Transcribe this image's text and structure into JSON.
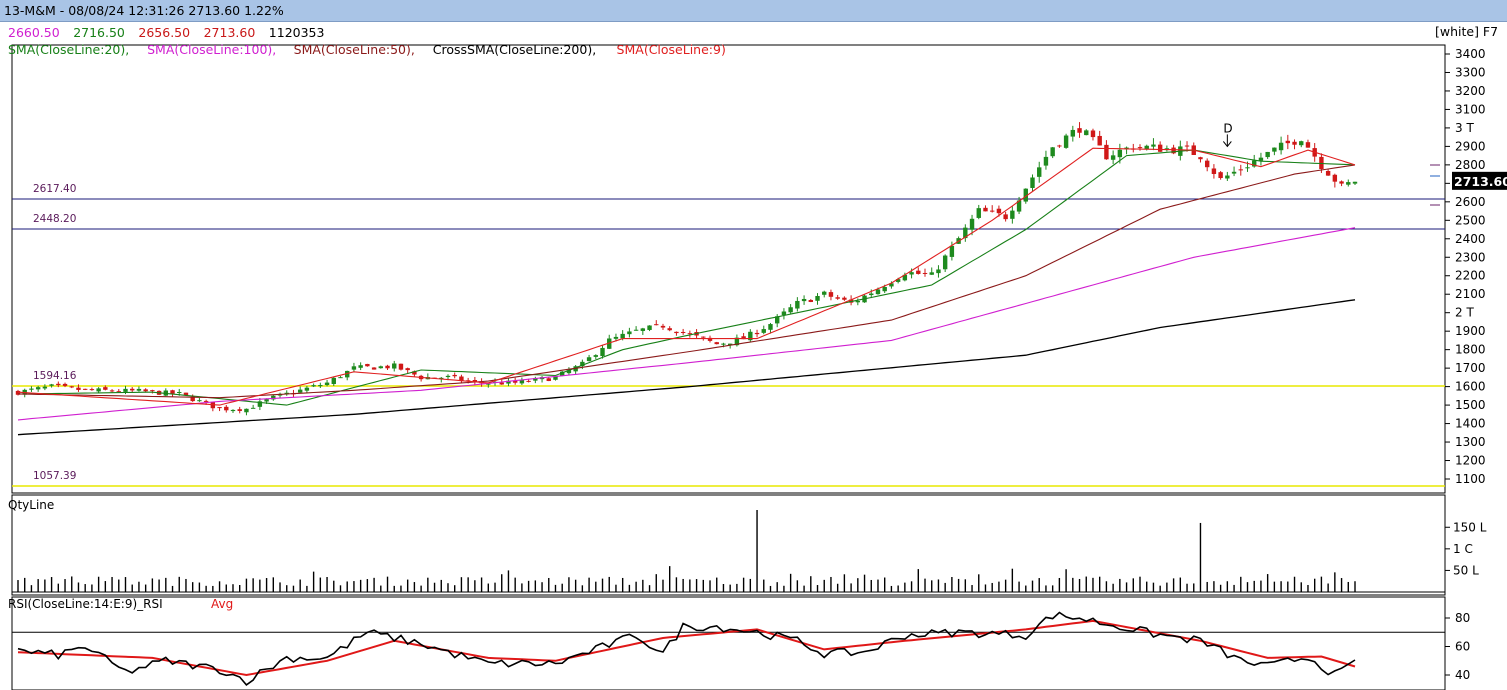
{
  "header": {
    "title": "13-M&M - 08/08/24 12:31:26 2713.60 1.22%",
    "ohlc": [
      {
        "text": "2660.50",
        "color": "#d020d0"
      },
      {
        "text": "2716.50",
        "color": "#188018"
      },
      {
        "text": "2656.50",
        "color": "#c81818"
      },
      {
        "text": "2713.60",
        "color": "#c81818"
      },
      {
        "text": "1120353",
        "color": "#000000"
      }
    ],
    "indicators": [
      {
        "text": "SMA(CloseLine:20),",
        "color": "#188018"
      },
      {
        "text": "SMA(CloseLine:100),",
        "color": "#d020d0"
      },
      {
        "text": "SMA(CloseLine:50),",
        "color": "#8b1a1a"
      },
      {
        "text": "CrossSMA(CloseLine:200),",
        "color": "#000000"
      },
      {
        "text": "SMA(CloseLine:9)",
        "color": "#e02020"
      }
    ],
    "theme_label": "[white] F7"
  },
  "chart_data": [
    {
      "type": "candlestick",
      "title": "13-M&M",
      "ylim": [
        1050,
        3450
      ],
      "y_ticks": [
        "3400",
        "3300",
        "3200",
        "3100",
        "3 T",
        "2900",
        "2800",
        "2700",
        "2600",
        "2500",
        "2400",
        "2300",
        "2200",
        "2100",
        "2 T",
        "1900",
        "1800",
        "1700",
        "1600",
        "1500",
        "1400",
        "1300",
        "1200",
        "1100"
      ],
      "last_price_label": "2713.60",
      "support_resistance": [
        {
          "label": "2617.40",
          "value": 2617.4,
          "color": "#1a1a7a"
        },
        {
          "label": "2448.20",
          "value": 2448.2,
          "color": "#1a1a7a"
        },
        {
          "label": "1594.16",
          "value": 1594.16,
          "color": "#e8e800"
        },
        {
          "label": "1057.39",
          "value": 1057.39,
          "color": "#e8e800"
        }
      ],
      "annotation": {
        "text": "D",
        "value": 2900
      },
      "close_path": [
        [
          0,
          1570
        ],
        [
          5,
          1600
        ],
        [
          10,
          1580
        ],
        [
          18,
          1575
        ],
        [
          24,
          1560
        ],
        [
          30,
          1480
        ],
        [
          34,
          1480
        ],
        [
          38,
          1540
        ],
        [
          42,
          1580
        ],
        [
          46,
          1620
        ],
        [
          50,
          1700
        ],
        [
          56,
          1710
        ],
        [
          60,
          1650
        ],
        [
          64,
          1650
        ],
        [
          68,
          1620
        ],
        [
          74,
          1620
        ],
        [
          80,
          1650
        ],
        [
          84,
          1720
        ],
        [
          88,
          1850
        ],
        [
          92,
          1900
        ],
        [
          96,
          1930
        ],
        [
          100,
          1880
        ],
        [
          104,
          1830
        ],
        [
          108,
          1860
        ],
        [
          112,
          1940
        ],
        [
          116,
          2050
        ],
        [
          120,
          2100
        ],
        [
          124,
          2050
        ],
        [
          128,
          2130
        ],
        [
          132,
          2220
        ],
        [
          136,
          2200
        ],
        [
          139,
          2350
        ],
        [
          143,
          2550
        ],
        [
          147,
          2520
        ],
        [
          150,
          2680
        ],
        [
          154,
          2900
        ],
        [
          158,
          3000
        ],
        [
          162,
          2850
        ],
        [
          166,
          2900
        ],
        [
          170,
          2890
        ],
        [
          174,
          2880
        ],
        [
          176,
          2850
        ],
        [
          179,
          2720
        ],
        [
          183,
          2800
        ],
        [
          187,
          2880
        ],
        [
          191,
          2950
        ],
        [
          194,
          2800
        ],
        [
          197,
          2680
        ],
        [
          199,
          2714
        ]
      ],
      "series": [
        {
          "name": "SMA(CloseLine:20)",
          "color": "#188018",
          "values": [
            [
              0,
              1560
            ],
            [
              20,
              1570
            ],
            [
              40,
              1500
            ],
            [
              60,
              1690
            ],
            [
              80,
              1660
            ],
            [
              90,
              1800
            ],
            [
              100,
              1880
            ],
            [
              120,
              2030
            ],
            [
              136,
              2150
            ],
            [
              150,
              2450
            ],
            [
              165,
              2850
            ],
            [
              175,
              2880
            ],
            [
              185,
              2820
            ],
            [
              199,
              2800
            ]
          ]
        },
        {
          "name": "SMA(CloseLine:100)",
          "color": "#d020d0",
          "values": [
            [
              0,
              1420
            ],
            [
              30,
              1520
            ],
            [
              60,
              1580
            ],
            [
              100,
              1730
            ],
            [
              130,
              1850
            ],
            [
              150,
              2050
            ],
            [
              175,
              2300
            ],
            [
              199,
              2460
            ]
          ]
        },
        {
          "name": "SMA(CloseLine:50)",
          "color": "#8b1a1a",
          "values": [
            [
              0,
              1560
            ],
            [
              30,
              1540
            ],
            [
              50,
              1580
            ],
            [
              70,
              1630
            ],
            [
              100,
              1790
            ],
            [
              130,
              1960
            ],
            [
              150,
              2200
            ],
            [
              170,
              2560
            ],
            [
              190,
              2750
            ],
            [
              199,
              2800
            ]
          ]
        },
        {
          "name": "CrossSMA(CloseLine:200)",
          "color": "#000000",
          "values": [
            [
              0,
              1340
            ],
            [
              50,
              1450
            ],
            [
              100,
              1600
            ],
            [
              150,
              1770
            ],
            [
              170,
              1920
            ],
            [
              199,
              2070
            ]
          ]
        },
        {
          "name": "SMA(CloseLine:9)",
          "color": "#e02020",
          "values": [
            [
              0,
              1570
            ],
            [
              30,
              1500
            ],
            [
              50,
              1680
            ],
            [
              70,
              1620
            ],
            [
              90,
              1860
            ],
            [
              110,
              1860
            ],
            [
              130,
              2160
            ],
            [
              145,
              2500
            ],
            [
              160,
              2890
            ],
            [
              175,
              2880
            ],
            [
              185,
              2790
            ],
            [
              192,
              2880
            ],
            [
              199,
              2800
            ]
          ]
        }
      ]
    },
    {
      "type": "bar",
      "title": "QtyLine",
      "y_ticks": [
        "150 L",
        "1 C",
        "50 L"
      ],
      "ylim": [
        0,
        190
      ],
      "spikes": [
        [
          7,
          30
        ],
        [
          8,
          36
        ],
        [
          97,
          60
        ],
        [
          110,
          190
        ],
        [
          148,
          54
        ],
        [
          176,
          160
        ]
      ]
    },
    {
      "type": "line",
      "title": "RSI(CloseLine:14:E:9)_RSI",
      "avg_label": "Avg",
      "ylim": [
        35,
        85
      ],
      "y_ticks": [
        80,
        60,
        40
      ],
      "reference_line": 70,
      "rsi_path": [
        [
          0,
          57
        ],
        [
          6,
          54
        ],
        [
          10,
          60
        ],
        [
          16,
          42
        ],
        [
          22,
          50
        ],
        [
          30,
          44
        ],
        [
          34,
          36
        ],
        [
          40,
          52
        ],
        [
          46,
          52
        ],
        [
          52,
          70
        ],
        [
          56,
          66
        ],
        [
          60,
          62
        ],
        [
          64,
          56
        ],
        [
          70,
          48
        ],
        [
          80,
          48
        ],
        [
          92,
          68
        ],
        [
          96,
          55
        ],
        [
          99,
          74
        ],
        [
          104,
          74
        ],
        [
          110,
          70
        ],
        [
          116,
          64
        ],
        [
          120,
          55
        ],
        [
          126,
          56
        ],
        [
          132,
          68
        ],
        [
          140,
          70
        ],
        [
          150,
          68
        ],
        [
          154,
          82
        ],
        [
          158,
          80
        ],
        [
          162,
          76
        ],
        [
          170,
          68
        ],
        [
          176,
          64
        ],
        [
          182,
          50
        ],
        [
          186,
          46
        ],
        [
          192,
          53
        ],
        [
          196,
          40
        ],
        [
          199,
          48
        ]
      ],
      "avg_path": [
        [
          0,
          56
        ],
        [
          20,
          52
        ],
        [
          34,
          40
        ],
        [
          46,
          50
        ],
        [
          56,
          64
        ],
        [
          70,
          52
        ],
        [
          80,
          50
        ],
        [
          96,
          66
        ],
        [
          110,
          72
        ],
        [
          120,
          58
        ],
        [
          132,
          64
        ],
        [
          150,
          72
        ],
        [
          160,
          78
        ],
        [
          176,
          64
        ],
        [
          186,
          52
        ],
        [
          194,
          53
        ],
        [
          199,
          46
        ]
      ]
    }
  ]
}
